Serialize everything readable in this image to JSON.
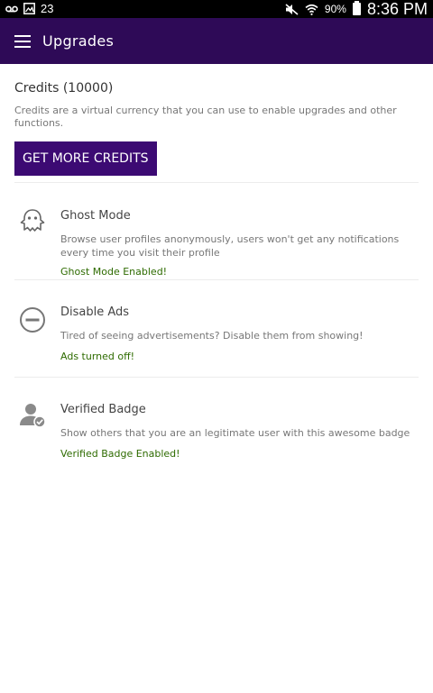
{
  "status_bar": {
    "notification_count": "23",
    "battery_percent": "90%",
    "time": "8:36 PM"
  },
  "app_bar": {
    "title": "Upgrades"
  },
  "credits": {
    "title": "Credits (10000)",
    "description": "Credits are a virtual currency that you can use to enable upgrades and other functions.",
    "button_label": "GET MORE CREDITS"
  },
  "upgrades": [
    {
      "icon": "ghost-icon",
      "title": "Ghost Mode",
      "description": "Browse user profiles anonymously, users won't get any notifications every time you visit their profile",
      "status": "Ghost Mode Enabled!"
    },
    {
      "icon": "no-entry-icon",
      "title": "Disable Ads",
      "description": "Tired of seeing advertisements? Disable them from showing!",
      "status": "Ads turned off!"
    },
    {
      "icon": "verified-user-icon",
      "title": "Verified Badge",
      "description": "Show others that you are an legitimate user with this awesome badge",
      "status": "Verified Badge Enabled!"
    }
  ],
  "colors": {
    "app_bar": "#2e0a57",
    "button": "#3c0a73",
    "status_text": "#2e6b00"
  }
}
